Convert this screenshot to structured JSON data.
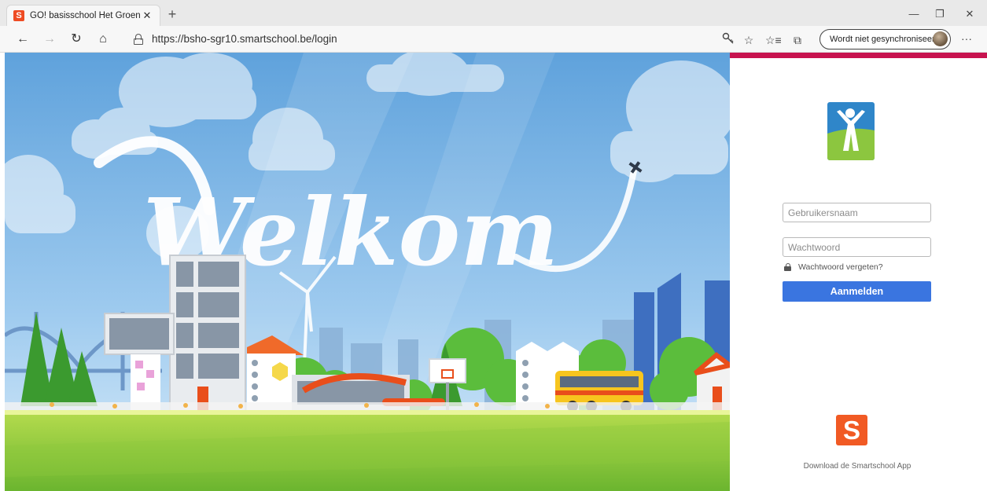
{
  "browser": {
    "tab": {
      "favicon": "S",
      "title": "GO! basisschool Het Groene Dal",
      "close": "✕"
    },
    "new_tab": "+",
    "window": {
      "minimize": "—",
      "restore": "❐",
      "close": "✕"
    },
    "nav": {
      "back": "←",
      "forward": "→",
      "refresh": "↻",
      "home": "⌂"
    },
    "url": "https://bsho-sgr10.smartschool.be/login",
    "icons": {
      "key": "key-icon",
      "favorite": "☆",
      "favorites_list": "☆≡",
      "collections": "⧉"
    },
    "profile": {
      "label": "Wordt niet gesynchroniseerd"
    },
    "more": "···"
  },
  "hero": {
    "welcome_text": "Welkom",
    "colors": {
      "sky": "#7fb6e6",
      "grass": "#7ec43a",
      "accent": "#e94e1b"
    }
  },
  "login": {
    "accent_color": "#c7134f",
    "username_placeholder": "Gebruikersnaam",
    "password_placeholder": "Wachtwoord",
    "forgot_label": "Wachtwoord vergeten?",
    "submit_label": "Aanmelden",
    "app_logo_letter": "S",
    "app_caption": "Download de Smartschool App"
  }
}
